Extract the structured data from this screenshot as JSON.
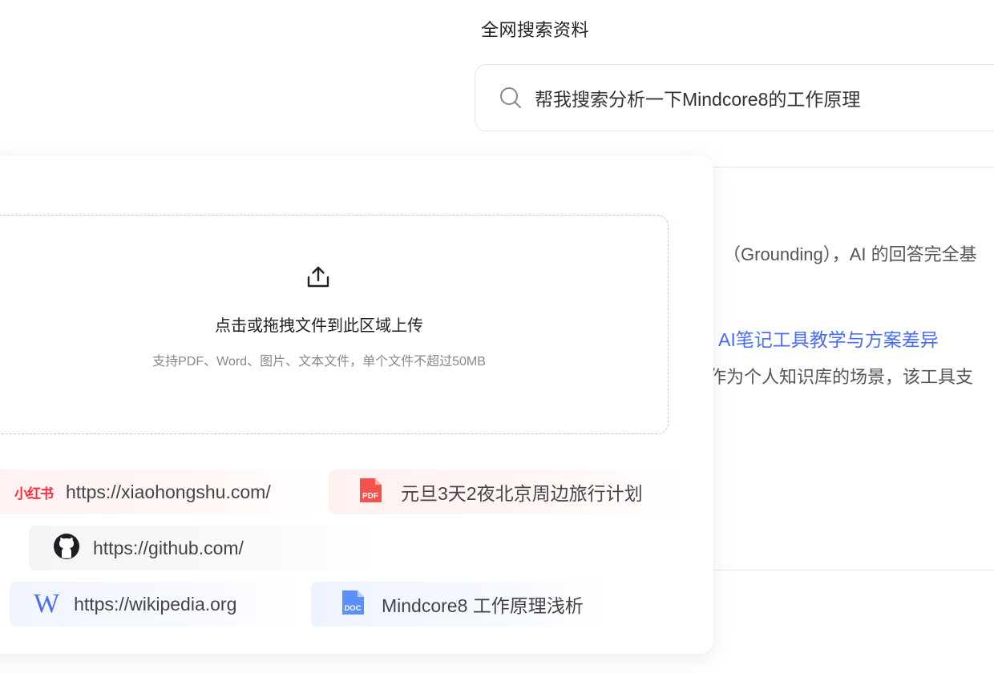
{
  "search": {
    "title": "全网搜索资料",
    "query": "帮我搜索分析一下Mindcore8的工作原理",
    "result_line1": "（Grounding），AI 的回答完全基",
    "result_link": "AI笔记工具教学与方案差异",
    "result_line2": "作为个人知识库的场景，该工具支"
  },
  "upload": {
    "title": "点击或拖拽文件到此区域上传",
    "subtitle": "支持PDF、Word、图片、文本文件，单个文件不超过50MB"
  },
  "sources": {
    "xiaohongshu": {
      "logo": "小红书",
      "url": "https://xiaohongshu.com/"
    },
    "pdf": {
      "icon_text": "PDF",
      "name": "元旦3天2夜北京周边旅行计划"
    },
    "github": {
      "url": "https://github.com/"
    },
    "wikipedia": {
      "logo": "W",
      "url": "https://wikipedia.org"
    },
    "doc": {
      "icon_text": "DOC",
      "name": "Mindcore8 工作原理浅析"
    }
  },
  "colors": {
    "accent_blue": "#4a6cf7",
    "xhs_red": "#ff2d3d",
    "pdf_red": "#f4524a",
    "doc_blue": "#5b8ff9",
    "dropzone_border": "#e3b4d2"
  }
}
